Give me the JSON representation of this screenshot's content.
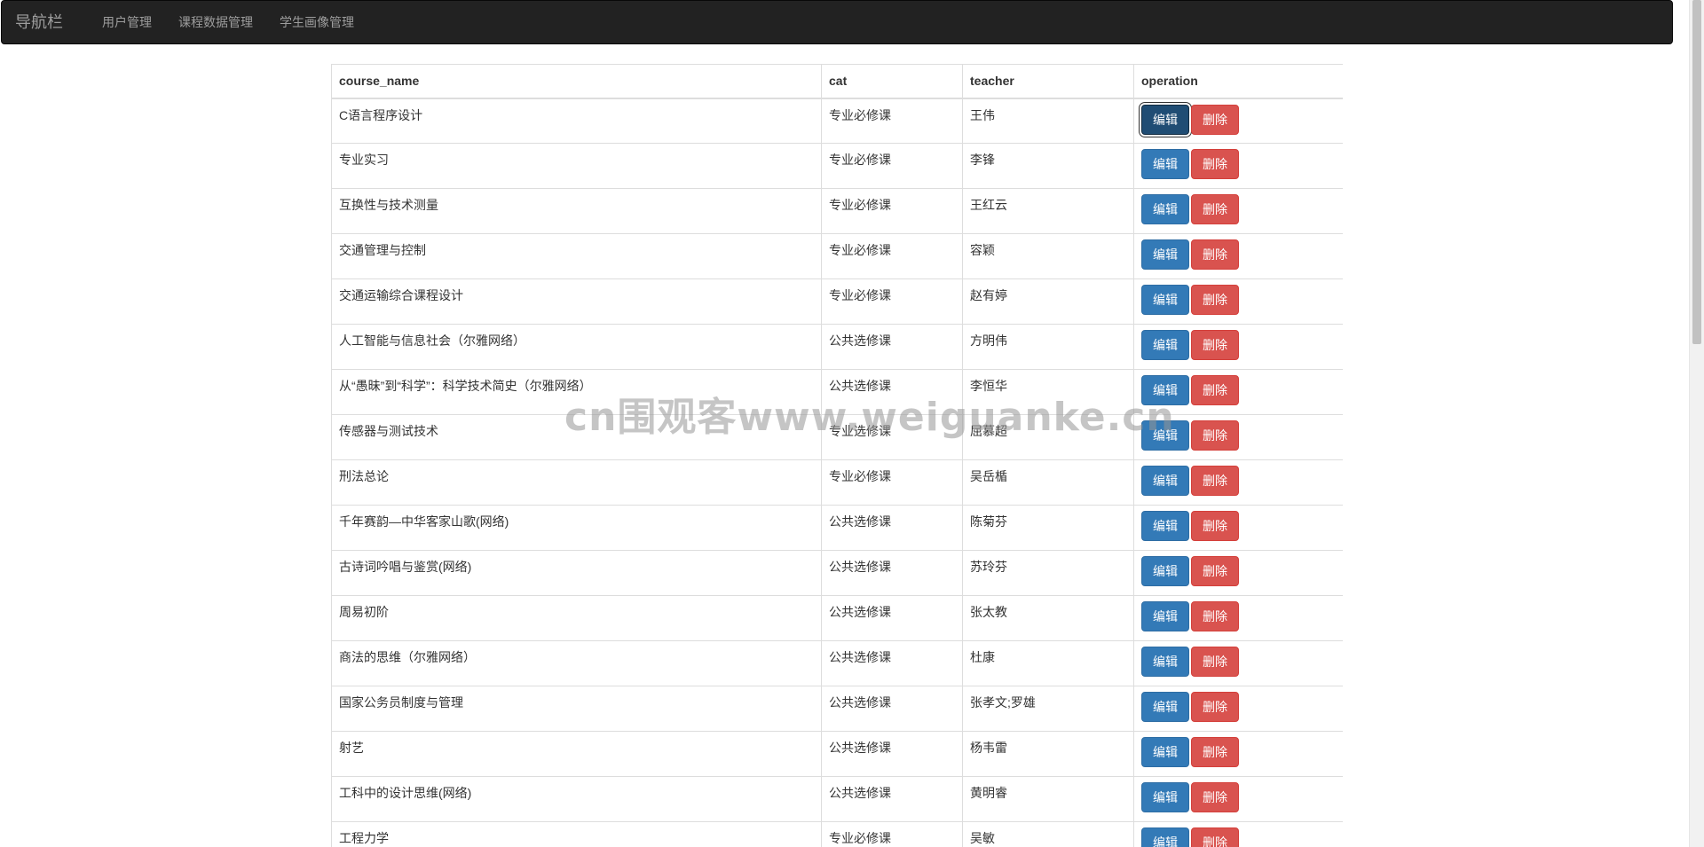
{
  "nav": {
    "brand": "导航栏",
    "items": [
      "用户管理",
      "课程数据管理",
      "学生画像管理"
    ]
  },
  "table": {
    "headers": [
      "course_name",
      "cat",
      "teacher",
      "operation"
    ],
    "edit_label": "编辑",
    "delete_label": "删除",
    "rows": [
      {
        "course_name": "C语言程序设计",
        "cat": "专业必修课",
        "teacher": "王伟"
      },
      {
        "course_name": "专业实习",
        "cat": "专业必修课",
        "teacher": "李锋"
      },
      {
        "course_name": "互换性与技术测量",
        "cat": "专业必修课",
        "teacher": "王红云"
      },
      {
        "course_name": "交通管理与控制",
        "cat": "专业必修课",
        "teacher": "容颖"
      },
      {
        "course_name": "交通运输综合课程设计",
        "cat": "专业必修课",
        "teacher": "赵有婷"
      },
      {
        "course_name": "人工智能与信息社会（尔雅网络）",
        "cat": "公共选修课",
        "teacher": "方明伟"
      },
      {
        "course_name": "从“愚昧”到“科学”：科学技术简史（尔雅网络）",
        "cat": "公共选修课",
        "teacher": "李恒华"
      },
      {
        "course_name": "传感器与测试技术",
        "cat": "专业选修课",
        "teacher": "屈慕超"
      },
      {
        "course_name": "刑法总论",
        "cat": "专业必修课",
        "teacher": "吴岳楯"
      },
      {
        "course_name": "千年赛韵—中华客家山歌(网络)",
        "cat": "公共选修课",
        "teacher": "陈菊芬"
      },
      {
        "course_name": "古诗词吟唱与鉴赏(网络)",
        "cat": "公共选修课",
        "teacher": "苏玲芬"
      },
      {
        "course_name": "周易初阶",
        "cat": "公共选修课",
        "teacher": "张太教"
      },
      {
        "course_name": "商法的思维（尔雅网络）",
        "cat": "公共选修课",
        "teacher": "杜康"
      },
      {
        "course_name": "国家公务员制度与管理",
        "cat": "公共选修课",
        "teacher": "张孝文;罗雄"
      },
      {
        "course_name": "射艺",
        "cat": "公共选修课",
        "teacher": "杨韦雷"
      },
      {
        "course_name": "工科中的设计思维(网络)",
        "cat": "公共选修课",
        "teacher": "黄明睿"
      },
      {
        "course_name": "工程力学",
        "cat": "专业必修课",
        "teacher": "吴敏"
      }
    ]
  },
  "watermark": "cn围观客www.weiguanke.cn",
  "colors": {
    "navbar_bg": "#222222",
    "edit_button": "#337ab7",
    "delete_button": "#d9534f"
  }
}
